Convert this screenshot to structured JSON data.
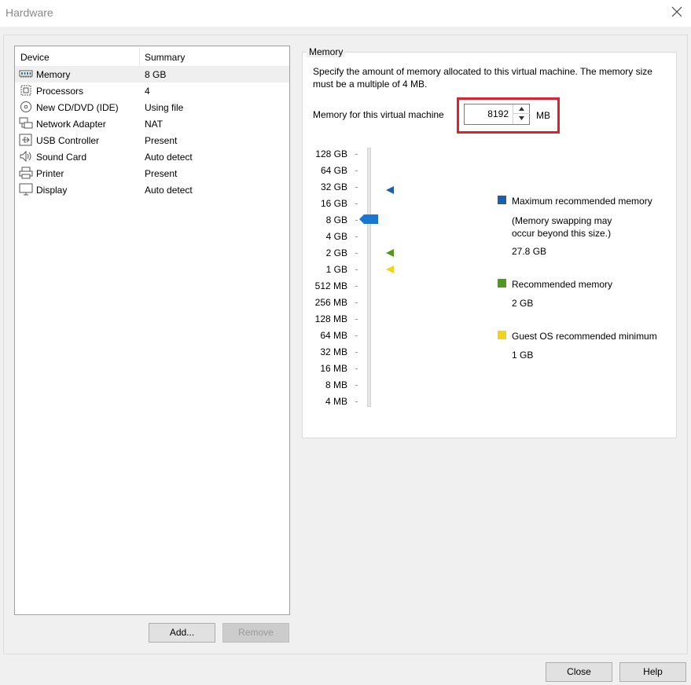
{
  "window": {
    "title": "Hardware"
  },
  "device_list": {
    "headers": {
      "device": "Device",
      "summary": "Summary"
    },
    "items": [
      {
        "name": "Memory",
        "summary": "8 GB",
        "icon": "memory-icon",
        "selected": true
      },
      {
        "name": "Processors",
        "summary": "4",
        "icon": "processor-icon"
      },
      {
        "name": "New CD/DVD (IDE)",
        "summary": "Using file",
        "icon": "cd-dvd-icon"
      },
      {
        "name": "Network Adapter",
        "summary": "NAT",
        "icon": "network-adapter-icon"
      },
      {
        "name": "USB Controller",
        "summary": "Present",
        "icon": "usb-icon"
      },
      {
        "name": "Sound Card",
        "summary": "Auto detect",
        "icon": "speaker-icon"
      },
      {
        "name": "Printer",
        "summary": "Present",
        "icon": "printer-icon"
      },
      {
        "name": "Display",
        "summary": "Auto detect",
        "icon": "monitor-icon"
      }
    ],
    "add_label": "Add...",
    "remove_label": "Remove"
  },
  "memory_panel": {
    "group_title": "Memory",
    "description": "Specify the amount of memory allocated to this virtual machine. The memory size must be a multiple of 4 MB.",
    "field_label": "Memory for this virtual machine",
    "value": "8192",
    "unit": "MB",
    "scale_labels": [
      "128 GB",
      "64 GB",
      "32 GB",
      "16 GB",
      "8 GB",
      "4 GB",
      "2 GB",
      "1 GB",
      "512 MB",
      "256 MB",
      "128 MB",
      "64 MB",
      "32 MB",
      "16 MB",
      "8 MB",
      "4 MB"
    ],
    "slider_value": "8 GB",
    "legend": {
      "max": {
        "label": "Maximum recommended memory",
        "note": "(Memory swapping may occur beyond this size.)",
        "value": "27.8 GB",
        "color": "#1a5fa8"
      },
      "recommended": {
        "label": "Recommended memory",
        "value": "2 GB",
        "color": "#4f9a1e"
      },
      "guest_min": {
        "label": "Guest OS recommended minimum",
        "value": "1 GB",
        "color": "#f2d31a"
      }
    },
    "thumb_color": "#1976d2",
    "highlight_color": "#e0202a"
  },
  "footer": {
    "close_label": "Close",
    "help_label": "Help"
  }
}
